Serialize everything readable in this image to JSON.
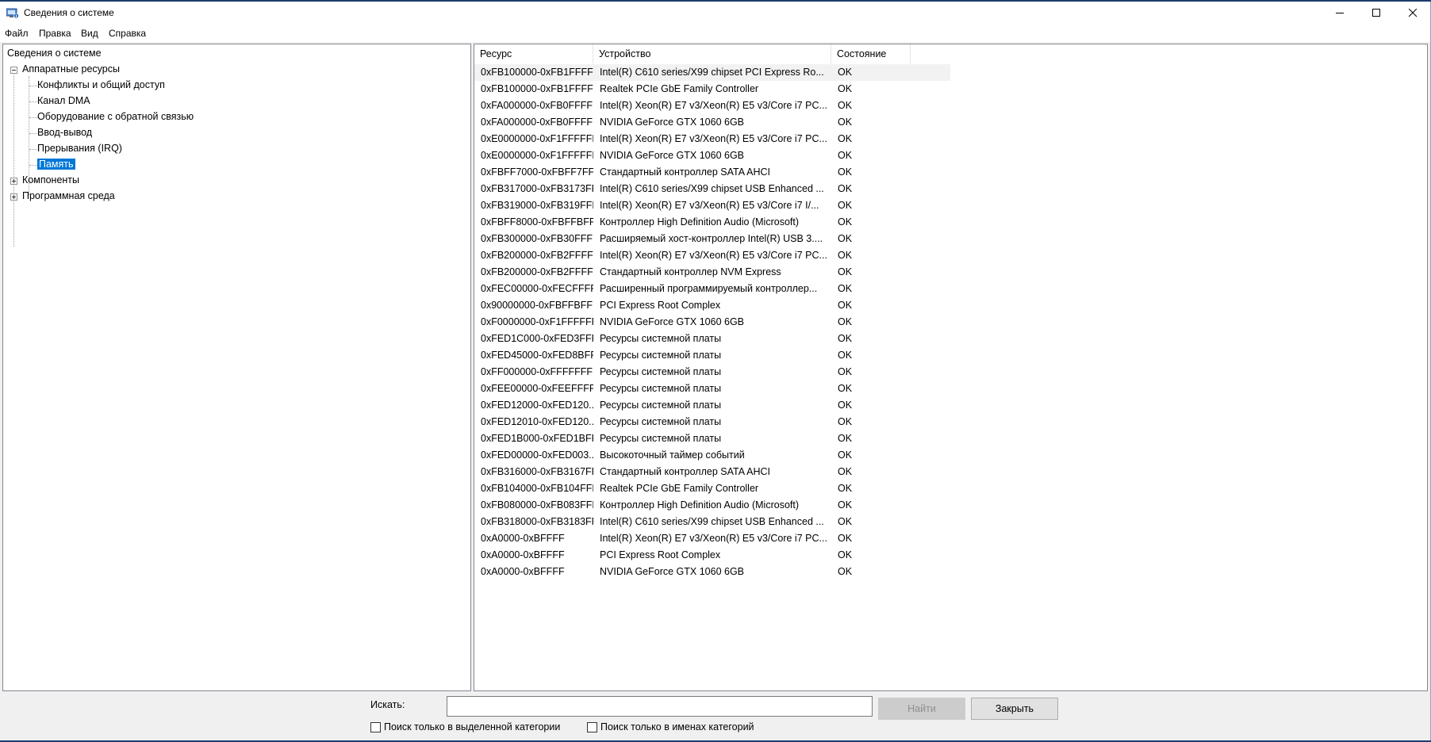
{
  "window": {
    "title": "Сведения о системе"
  },
  "menu": [
    "Файл",
    "Правка",
    "Вид",
    "Справка"
  ],
  "tree": {
    "root": "Сведения о системе",
    "hardware": "Аппаратные ресурсы",
    "hardware_children": [
      "Конфликты и общий доступ",
      "Канал DMA",
      "Оборудование с обратной связью",
      "Ввод-вывод",
      "Прерывания (IRQ)",
      "Память"
    ],
    "components": "Компоненты",
    "software": "Программная среда"
  },
  "table": {
    "columns": [
      "Ресурс",
      "Устройство",
      "Состояние"
    ],
    "rows": [
      [
        "0xFB100000-0xFB1FFFFF",
        "Intel(R) C610 series/X99 chipset PCI Express Ro...",
        "OK"
      ],
      [
        "0xFB100000-0xFB1FFFFF",
        "Realtek PCIe GbE Family Controller",
        "OK"
      ],
      [
        "0xFA000000-0xFB0FFFFF",
        "Intel(R) Xeon(R) E7 v3/Xeon(R) E5 v3/Core i7 PC...",
        "OK"
      ],
      [
        "0xFA000000-0xFB0FFFFF",
        "NVIDIA GeForce GTX 1060 6GB",
        "OK"
      ],
      [
        "0xE0000000-0xF1FFFFFF",
        "Intel(R) Xeon(R) E7 v3/Xeon(R) E5 v3/Core i7 PC...",
        "OK"
      ],
      [
        "0xE0000000-0xF1FFFFFF",
        "NVIDIA GeForce GTX 1060 6GB",
        "OK"
      ],
      [
        "0xFBFF7000-0xFBFF7FFF",
        "Стандартный контроллер SATA AHCI",
        "OK"
      ],
      [
        "0xFB317000-0xFB3173FF",
        "Intel(R) C610 series/X99 chipset USB Enhanced ...",
        "OK"
      ],
      [
        "0xFB319000-0xFB319FFF",
        "Intel(R) Xeon(R) E7 v3/Xeon(R) E5 v3/Core i7 I/...",
        "OK"
      ],
      [
        "0xFBFF8000-0xFBFFBFFF",
        "Контроллер High Definition Audio (Microsoft)",
        "OK"
      ],
      [
        "0xFB300000-0xFB30FFFF",
        "Расширяемый хост-контроллер Intel(R) USB 3....",
        "OK"
      ],
      [
        "0xFB200000-0xFB2FFFFF",
        "Intel(R) Xeon(R) E7 v3/Xeon(R) E5 v3/Core i7 PC...",
        "OK"
      ],
      [
        "0xFB200000-0xFB2FFFFF",
        "Стандартный контроллер NVM Express",
        "OK"
      ],
      [
        "0xFEC00000-0xFECFFFFF",
        "Расширенный программируемый контроллер...",
        "OK"
      ],
      [
        "0x90000000-0xFBFFBFFF",
        "PCI Express Root Complex",
        "OK"
      ],
      [
        "0xF0000000-0xF1FFFFFF",
        "NVIDIA GeForce GTX 1060 6GB",
        "OK"
      ],
      [
        "0xFED1C000-0xFED3FFFF",
        "Ресурсы системной платы",
        "OK"
      ],
      [
        "0xFED45000-0xFED8BFFF",
        "Ресурсы системной платы",
        "OK"
      ],
      [
        "0xFF000000-0xFFFFFFFF",
        "Ресурсы системной платы",
        "OK"
      ],
      [
        "0xFEE00000-0xFEEFFFFF",
        "Ресурсы системной платы",
        "OK"
      ],
      [
        "0xFED12000-0xFED120...",
        "Ресурсы системной платы",
        "OK"
      ],
      [
        "0xFED12010-0xFED120...",
        "Ресурсы системной платы",
        "OK"
      ],
      [
        "0xFED1B000-0xFED1BFFF",
        "Ресурсы системной платы",
        "OK"
      ],
      [
        "0xFED00000-0xFED003...",
        "Высокоточный таймер событий",
        "OK"
      ],
      [
        "0xFB316000-0xFB3167FF",
        "Стандартный контроллер SATA AHCI",
        "OK"
      ],
      [
        "0xFB104000-0xFB104FFF",
        "Realtek PCIe GbE Family Controller",
        "OK"
      ],
      [
        "0xFB080000-0xFB083FFF",
        "Контроллер High Definition Audio (Microsoft)",
        "OK"
      ],
      [
        "0xFB318000-0xFB3183FF",
        "Intel(R) C610 series/X99 chipset USB Enhanced ...",
        "OK"
      ],
      [
        "0xA0000-0xBFFFF",
        "Intel(R) Xeon(R) E7 v3/Xeon(R) E5 v3/Core i7 PC...",
        "OK"
      ],
      [
        "0xA0000-0xBFFFF",
        "PCI Express Root Complex",
        "OK"
      ],
      [
        "0xA0000-0xBFFFF",
        "NVIDIA GeForce GTX 1060 6GB",
        "OK"
      ]
    ]
  },
  "search": {
    "label": "Искать:",
    "value": "",
    "find_button": "Найти",
    "close_button": "Закрыть",
    "checkbox_selected_category": "Поиск только в выделенной категории",
    "checkbox_category_names": "Поиск только в именах категорий"
  },
  "colors": {
    "selection": "#0078d7",
    "border": "#828790"
  }
}
